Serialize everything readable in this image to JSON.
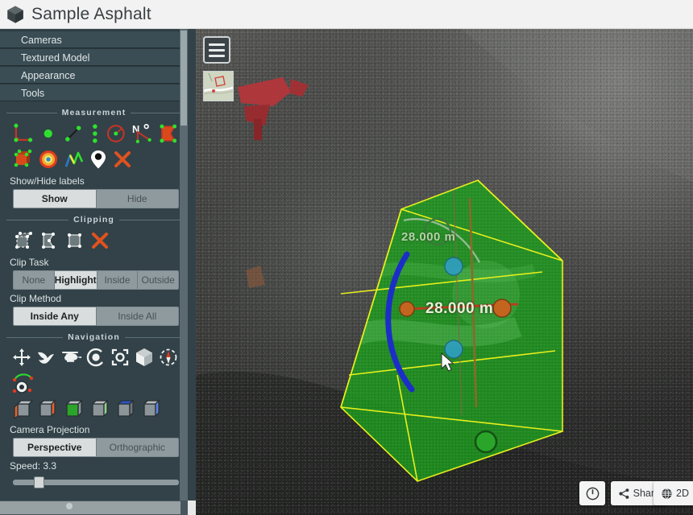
{
  "titlebar": {
    "logo_icon": "cube-logo-icon",
    "title": "Sample Asphalt"
  },
  "sidebar": {
    "menu": [
      {
        "label": "Cameras",
        "name": "cameras"
      },
      {
        "label": "Textured Model",
        "name": "textured-model"
      },
      {
        "label": "Appearance",
        "name": "appearance"
      },
      {
        "label": "Tools",
        "name": "tools"
      }
    ],
    "measurement": {
      "header": "Measurement",
      "tools_row1": [
        "angle-measure-icon",
        "point-measure-icon",
        "distance-measure-icon",
        "height-measure-icon",
        "circle-measure-icon",
        "azimuth-measure-icon",
        "area-measure-icon"
      ],
      "tools_row2": [
        "volume-measure-icon",
        "heightmap-measure-icon",
        "profile-measure-icon",
        "annotation-pin-icon",
        "remove-measurement-icon"
      ],
      "labels_field": "Show/Hide labels",
      "show_label": "Show",
      "hide_label": "Hide",
      "labels_selected": "Show"
    },
    "clipping": {
      "header": "Clipping",
      "tools": [
        "clip-volume-icon",
        "clip-polygon-icon",
        "clip-plane-icon",
        "remove-clip-icon"
      ],
      "clip_task_label": "Clip Task",
      "clip_task_options": [
        "None",
        "Highlight",
        "Inside",
        "Outside"
      ],
      "clip_task_selected": "Highlight",
      "clip_method_label": "Clip Method",
      "clip_method_options": [
        "Inside Any",
        "Inside All"
      ],
      "clip_method_selected": "Inside Any"
    },
    "navigation": {
      "header": "Navigation",
      "tools_row1": [
        "pan-navigation-icon",
        "fly-navigation-icon",
        "helicopter-navigation-icon",
        "orbit-navigation-icon",
        "focus-navigation-icon",
        "cube-navigation-icon",
        "compass-navigation-icon"
      ],
      "tools_row2": [
        "camera-animation-icon"
      ],
      "view_cubes": [
        "view-left-icon",
        "view-right-icon",
        "view-front-icon",
        "view-back-icon",
        "view-top-icon",
        "view-bottom-icon"
      ],
      "camera_projection_label": "Camera Projection",
      "projection_options": [
        "Perspective",
        "Orthographic"
      ],
      "projection_selected": "Perspective",
      "speed_label": "Speed: 3.3",
      "speed_value": 3.3
    }
  },
  "viewport": {
    "menu_icon": "hamburger-menu-icon",
    "minimap_icon": "minimap-thumbnail",
    "measurement_labels": [
      {
        "text": "28.000 m",
        "name": "distance-label-28"
      },
      {
        "text": "28.000 m",
        "name": "distance-label-top"
      }
    ],
    "controls": {
      "info_icon": "power-info-icon",
      "share_icon": "share-icon",
      "share_label": "Share",
      "globe_icon": "globe-icon",
      "mode_label": "2D"
    }
  },
  "colors": {
    "titlebar_bg": "#f2f2f2",
    "sidebar_bg": "#324248",
    "menu_item_bg": "#3b4d54",
    "accent_green": "#2aa52a",
    "clip_edge_yellow": "#e8f01c",
    "gizmo_blue": "#1b2ec8",
    "gizmo_orange": "#c4651f",
    "measure_red": "#c43426"
  }
}
